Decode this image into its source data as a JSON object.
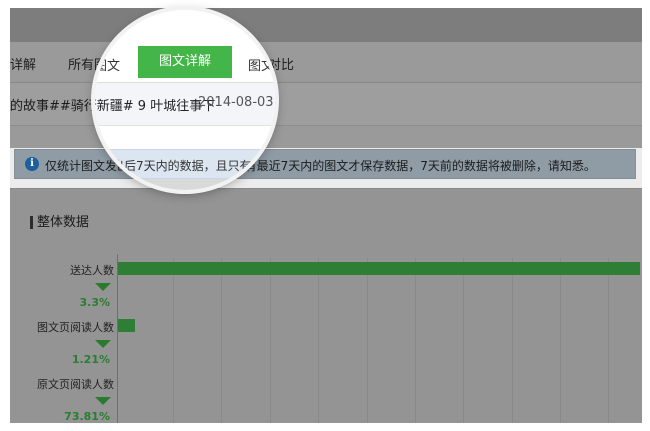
{
  "tabs": {
    "detail_partial": "详解",
    "all_articles_partial": "所有图文",
    "active": "图文详解",
    "compare_partial": "图文对比"
  },
  "article": {
    "title": "的故事##骑行新疆# 9 叶城往事下",
    "date": "2014-08-03"
  },
  "notice": {
    "text": "仅统计图文发出后7天内的数据，且只有最近7天内的图文才保存数据，7天前的数据将被删除，请知悉。"
  },
  "section": {
    "title": "整体数据"
  },
  "chart_data": {
    "type": "bar",
    "orientation": "horizontal",
    "categories": [
      "送达人数",
      "图文页阅读人数",
      "原文页阅读人数"
    ],
    "values": [
      1.0,
      0.033,
      0.0004
    ],
    "conversion_rates": [
      "3.3%",
      "1.21%",
      "73.81%"
    ],
    "grid": true
  },
  "colors": {
    "accent_green": "#44b549",
    "bar_green": "#2f7e35",
    "info_blue": "#1d5e9c"
  },
  "icons": {
    "notice": "info-icon",
    "rate_marker": "arrow-down-icon"
  }
}
